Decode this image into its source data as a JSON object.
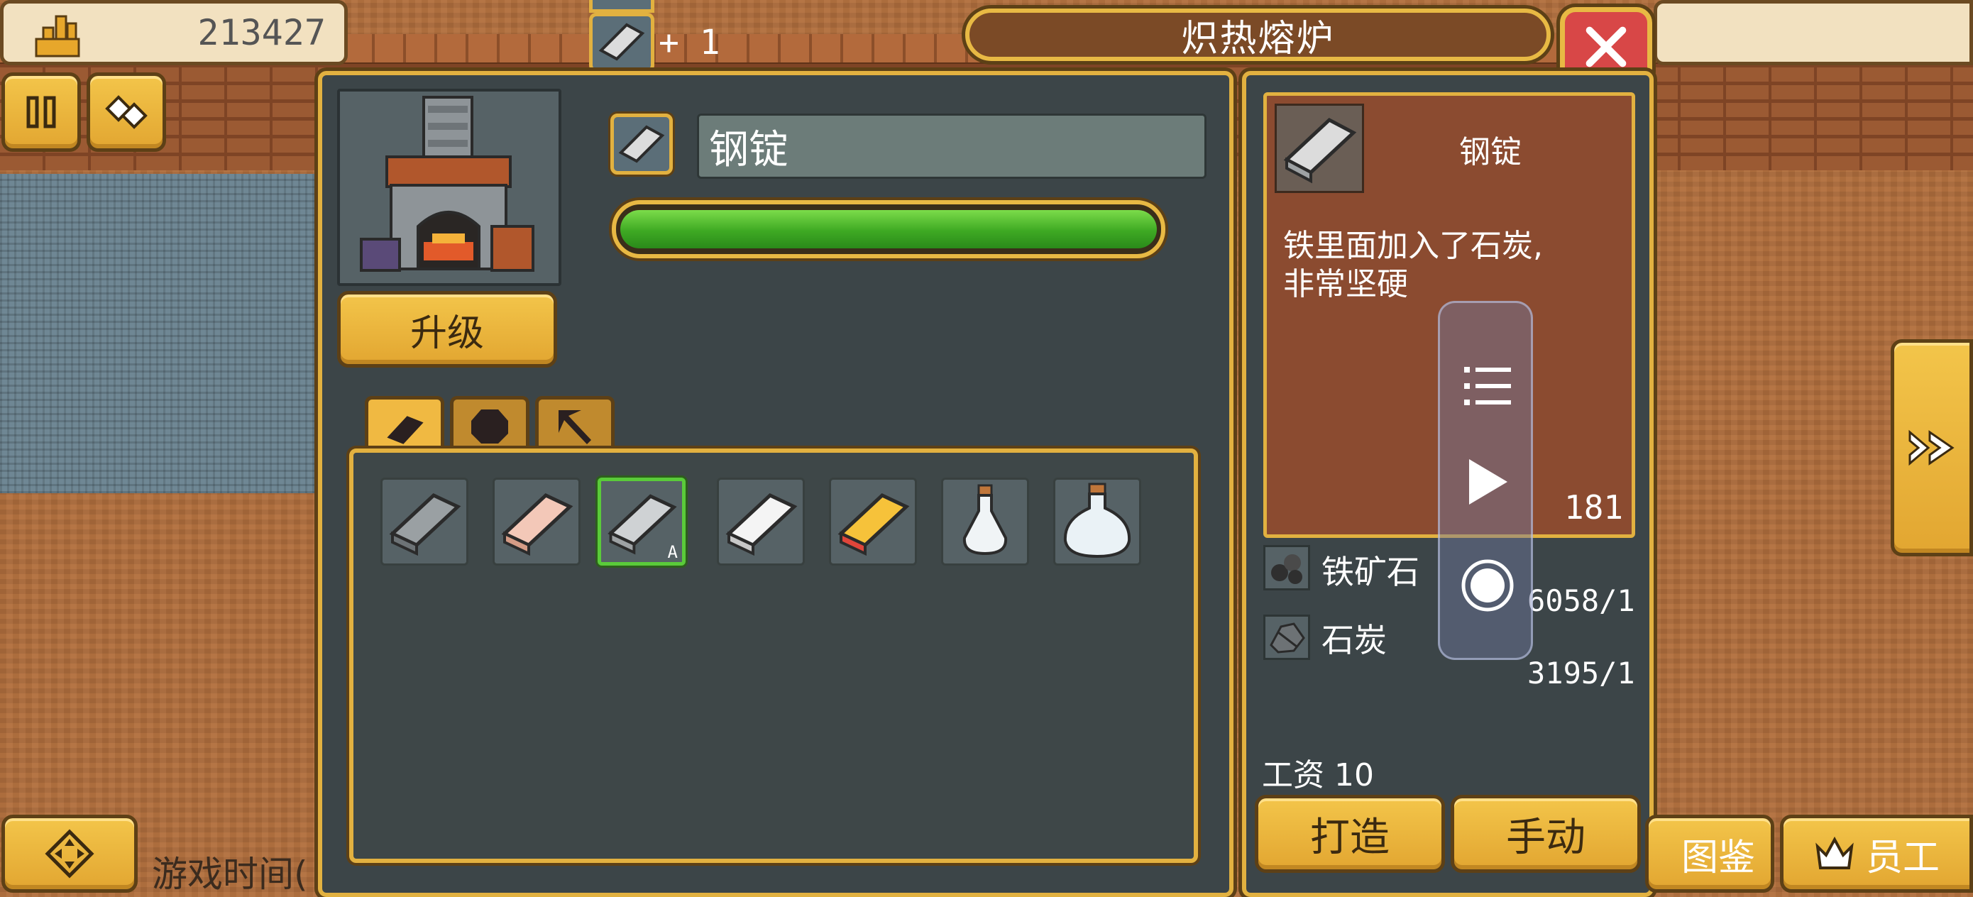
{
  "hud": {
    "money": "213427",
    "title": "炽热熔炉",
    "queue_count": "+ 1"
  },
  "furnace": {
    "upgrade_label": "升级"
  },
  "product": {
    "name": "钢锭",
    "progress_percent": 100
  },
  "tabs": [
    {
      "icon": "bar-icon",
      "active": true
    },
    {
      "icon": "gem-icon",
      "active": false
    },
    {
      "icon": "pickaxe-icon",
      "active": false
    }
  ],
  "recipes": [
    {
      "icon": "iron-ingot-icon"
    },
    {
      "icon": "copper-ingot-icon"
    },
    {
      "icon": "steel-ingot-icon",
      "selected": true,
      "tag": "A"
    },
    {
      "icon": "silver-ingot-icon"
    },
    {
      "icon": "gold-ingot-icon"
    },
    {
      "icon": "small-potion-icon"
    },
    {
      "icon": "large-potion-icon"
    }
  ],
  "detail": {
    "name": "钢锭",
    "description_line1": "铁里面加入了石炭,",
    "description_line2": "非常坚硬",
    "count": "181"
  },
  "materials": [
    {
      "name": "铁矿石",
      "qty": "6058/1",
      "icon": "iron-ore-icon"
    },
    {
      "name": "石炭",
      "qty": "3195/1",
      "icon": "coal-icon"
    }
  ],
  "wage": "工资 10",
  "actions": {
    "craft_label": "打造",
    "manual_label": "手动"
  },
  "bottom": {
    "book_label": "图鉴",
    "staff_label": "员工",
    "game_time_label": "游戏时间("
  },
  "colors": {
    "gold_border": "#e2b140",
    "panel": "#3c4548",
    "progress_green": "#3ea923",
    "close_red": "#d84747",
    "detail_brown": "#8b4b30"
  }
}
